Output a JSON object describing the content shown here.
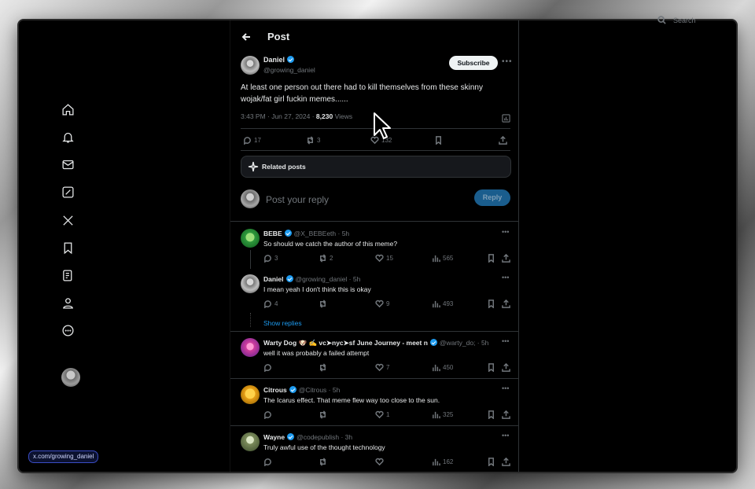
{
  "header": {
    "title": "Post"
  },
  "search": {
    "label": "Search"
  },
  "post": {
    "author_name": "Daniel",
    "author_handle": "@growing_daniel",
    "subscribe_label": "Subscribe",
    "text": "At least one person out there had to kill themselves from these skinny wojak/fat girl fuckin memes......",
    "time": "3:43 PM · Jun 27, 2024 · ",
    "views_count": "8,230",
    "views_label": " Views",
    "stats": {
      "replies": "17",
      "reposts": "3",
      "likes": "132"
    }
  },
  "related": {
    "label": "Related posts"
  },
  "reply_box": {
    "placeholder": "Post your reply",
    "button_label": "Reply"
  },
  "replies": [
    {
      "name": "BEBE",
      "handle": "@X_BEBEeth · 5h",
      "text": "So should we catch the author of this meme?",
      "replies": "3",
      "reposts": "2",
      "likes": "15",
      "views": "565"
    },
    {
      "name": "Daniel",
      "handle": "@growing_daniel · 5h",
      "text": "I mean yeah I don't think this is okay",
      "replies": "4",
      "reposts": "",
      "likes": "9",
      "views": "493"
    },
    {
      "name": "Warty Dog 🐶 ✍️ vc➤nyc➤sf June Journey - meet n",
      "handle": "@warty_do; · 5h",
      "text": "well it was probably a failed attempt",
      "replies": "",
      "reposts": "",
      "likes": "7",
      "views": "450"
    },
    {
      "name": "Citrous",
      "handle": "@Citrous · 5h",
      "text": "The Icarus effect. That meme flew way too close to the sun.",
      "replies": "",
      "reposts": "",
      "likes": "1",
      "views": "325"
    },
    {
      "name": "Wayne",
      "handle": "@codepublish · 3h",
      "text": "Truly awful use of the thought technology",
      "replies": "",
      "reposts": "",
      "likes": "",
      "views": "162"
    }
  ],
  "show_replies": "Show replies",
  "status_url": "x.com/growing_daniel",
  "colors": {
    "accent": "#1d9bf0",
    "background": "#000000",
    "muted": "#71767b"
  }
}
